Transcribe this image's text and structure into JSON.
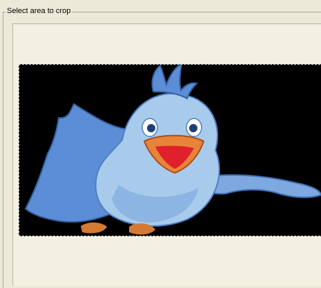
{
  "crop_group": {
    "label": "Select area to crop"
  },
  "image": {
    "subject": "blue-bird-illustration",
    "background_color": "#000000",
    "bird_colors": {
      "body": "#9cc4e8",
      "body_shadow": "#5d8fd0",
      "wing": "#5b8ed6",
      "beak_outer": "#e8833a",
      "mouth": "#e0202a",
      "eye_white": "#ffffff",
      "pupil": "#1f3f7a",
      "feet": "#d57a33"
    }
  }
}
